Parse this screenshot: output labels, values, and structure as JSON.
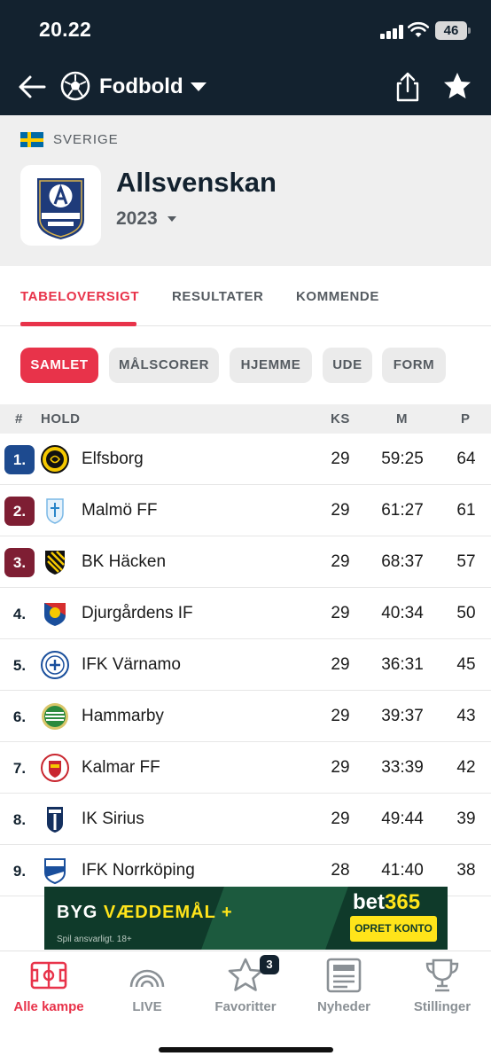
{
  "status_bar": {
    "time": "20.22",
    "battery": "46"
  },
  "header": {
    "sport": "Fodbold",
    "back_icon": "arrow-left-icon",
    "sport_icon": "football-icon",
    "share_icon": "share-icon",
    "favorite_icon": "star-icon"
  },
  "league": {
    "country": "SVERIGE",
    "name": "Allsvenskan",
    "season": "2023",
    "logo_text": "ALLSVENSKAN",
    "logo_sponsor": "UNIBET"
  },
  "tabs": [
    {
      "label": "TABELOVERSIGT"
    },
    {
      "label": "RESULTATER"
    },
    {
      "label": "KOMMENDE"
    }
  ],
  "filters": [
    {
      "label": "SAMLET"
    },
    {
      "label": "MÅLSCORER"
    },
    {
      "label": "HJEMME"
    },
    {
      "label": "UDE"
    },
    {
      "label": "FORM"
    }
  ],
  "table": {
    "columns": {
      "rank": "#",
      "team": "HOLD",
      "played": "KS",
      "goals": "M",
      "points": "P"
    },
    "rows": [
      {
        "rank": "1.",
        "team": "Elfsborg",
        "played": "29",
        "goals": "59:25",
        "points": "64"
      },
      {
        "rank": "2.",
        "team": "Malmö FF",
        "played": "29",
        "goals": "61:27",
        "points": "61"
      },
      {
        "rank": "3.",
        "team": "BK Häcken",
        "played": "29",
        "goals": "68:37",
        "points": "57"
      },
      {
        "rank": "4.",
        "team": "Djurgårdens IF",
        "played": "29",
        "goals": "40:34",
        "points": "50"
      },
      {
        "rank": "5.",
        "team": "IFK Värnamo",
        "played": "29",
        "goals": "36:31",
        "points": "45"
      },
      {
        "rank": "6.",
        "team": "Hammarby",
        "played": "29",
        "goals": "39:37",
        "points": "43"
      },
      {
        "rank": "7.",
        "team": "Kalmar FF",
        "played": "29",
        "goals": "33:39",
        "points": "42"
      },
      {
        "rank": "8.",
        "team": "IK Sirius",
        "played": "29",
        "goals": "49:44",
        "points": "39"
      },
      {
        "rank": "9.",
        "team": "IFK Norrköping",
        "played": "28",
        "goals": "41:40",
        "points": "38"
      }
    ]
  },
  "ad": {
    "headline_start": "BYG ",
    "headline_accent": "VÆDDEMÅL +",
    "disclaimer": "Spil ansvarligt. 18+",
    "brand_main": "bet",
    "brand_num": "365",
    "cta": "OPRET KONTO"
  },
  "bottom_nav": [
    {
      "label": "Alle kampe",
      "icon": "pitch-icon"
    },
    {
      "label": "LIVE",
      "icon": "live-icon"
    },
    {
      "label": "Favoritter",
      "icon": "star-outline-icon",
      "badge": "3"
    },
    {
      "label": "Nyheder",
      "icon": "news-icon"
    },
    {
      "label": "Stillinger",
      "icon": "trophy-icon"
    }
  ],
  "colors": {
    "header_bg": "#13222f",
    "accent": "#e8334a",
    "rank_blue": "#1d4a8f",
    "rank_maroon": "#7e1e33"
  }
}
